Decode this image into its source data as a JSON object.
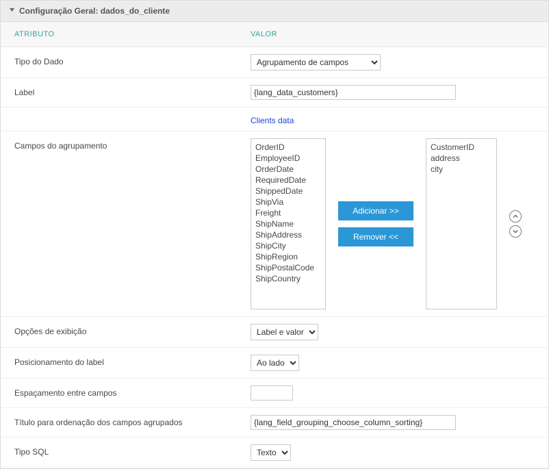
{
  "header": {
    "title": "Configuração Geral: dados_do_cliente"
  },
  "columns": {
    "attribute": "ATRIBUTO",
    "value": "VALOR"
  },
  "fields": {
    "data_type": {
      "label": "Tipo do Dado",
      "value": "Agrupamento de campos"
    },
    "label": {
      "label": "Label",
      "value": "{lang_data_customers}"
    },
    "label_preview": "Clients data",
    "grouping_fields": {
      "label": "Campos do agrupamento"
    },
    "available": [
      "OrderID",
      "EmployeeID",
      "OrderDate",
      "RequiredDate",
      "ShippedDate",
      "ShipVia",
      "Freight",
      "ShipName",
      "ShipAddress",
      "ShipCity",
      "ShipRegion",
      "ShipPostalCode",
      "ShipCountry"
    ],
    "selected": [
      "CustomerID",
      "address",
      "city"
    ],
    "buttons": {
      "add": "Adicionar >>",
      "remove": "Remover  <<"
    },
    "display_options": {
      "label": "Opções de exibição",
      "value": "Label e valor"
    },
    "label_position": {
      "label": "Posicionamento do label",
      "value": "Ao lado"
    },
    "spacing": {
      "label": "Espaçamento entre campos",
      "value": ""
    },
    "sort_title": {
      "label": "Título para ordenação dos campos agrupados",
      "value": "{lang_field_grouping_choose_column_sorting}"
    },
    "sql_type": {
      "label": "Tipo SQL",
      "value": "Texto"
    }
  }
}
